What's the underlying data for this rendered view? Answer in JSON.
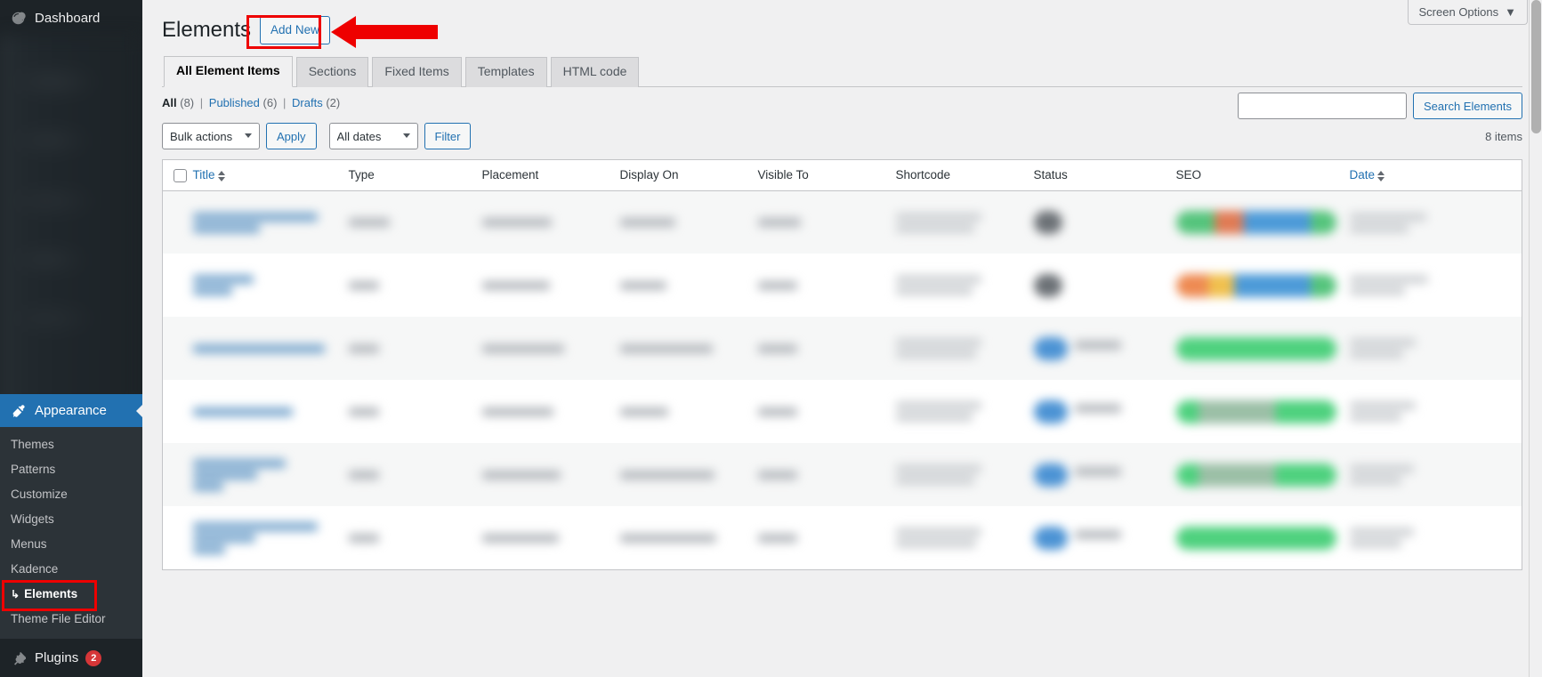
{
  "sidebar": {
    "dashboard": {
      "label": "Dashboard",
      "icon": "dashboard-icon"
    },
    "appearance": {
      "label": "Appearance",
      "icon": "paintbrush-icon"
    },
    "submenu": [
      {
        "label": "Themes",
        "current": false
      },
      {
        "label": "Patterns",
        "current": false
      },
      {
        "label": "Customize",
        "current": false
      },
      {
        "label": "Widgets",
        "current": false
      },
      {
        "label": "Menus",
        "current": false
      },
      {
        "label": "Kadence",
        "current": false
      },
      {
        "label": "Elements",
        "current": true,
        "prefix": "↳"
      },
      {
        "label": "Theme File Editor",
        "current": false
      }
    ],
    "plugins": {
      "label": "Plugins",
      "badge": "2",
      "icon": "plug-icon"
    }
  },
  "header": {
    "screen_options": "Screen Options",
    "screen_options_icon": "chevron-down-icon",
    "page_title": "Elements",
    "add_new": "Add New"
  },
  "tabs": [
    {
      "label": "All Element Items",
      "active": true
    },
    {
      "label": "Sections",
      "active": false
    },
    {
      "label": "Fixed Items",
      "active": false
    },
    {
      "label": "Templates",
      "active": false
    },
    {
      "label": "HTML code",
      "active": false
    }
  ],
  "status_links": [
    {
      "label": "All",
      "count": "(8)",
      "current": true
    },
    {
      "label": "Published",
      "count": "(6)",
      "current": false
    },
    {
      "label": "Drafts",
      "count": "(2)",
      "current": false
    }
  ],
  "search": {
    "value": "",
    "placeholder": "",
    "button": "Search Elements"
  },
  "tablenav": {
    "bulk_actions": "Bulk actions",
    "apply": "Apply",
    "all_dates": "All dates",
    "filter": "Filter",
    "items_count": "8 items"
  },
  "table": {
    "columns": [
      {
        "label": "Title",
        "sortable": true
      },
      {
        "label": "Type",
        "sortable": false
      },
      {
        "label": "Placement",
        "sortable": false
      },
      {
        "label": "Display On",
        "sortable": false
      },
      {
        "label": "Visible To",
        "sortable": false
      },
      {
        "label": "Shortcode",
        "sortable": false
      },
      {
        "label": "Status",
        "sortable": false
      },
      {
        "label": "SEO",
        "sortable": false
      },
      {
        "label": "Date",
        "sortable": true
      }
    ],
    "rows_blurred": true,
    "row_count": 6
  },
  "annotations": {
    "highlight_color": "#ee0000",
    "arrow_color": "#ee0000",
    "highlighted_elements": [
      "add-new-button",
      "sidebar-item-elements"
    ]
  },
  "colors": {
    "accent": "#2271b1",
    "sidebar_bg": "#1d2327",
    "submenu_bg": "#2c3338",
    "badge": "#d63638",
    "page_bg": "#f0f0f1",
    "seo_green": "#4ed17e",
    "status_blue": "#4c93d4"
  }
}
